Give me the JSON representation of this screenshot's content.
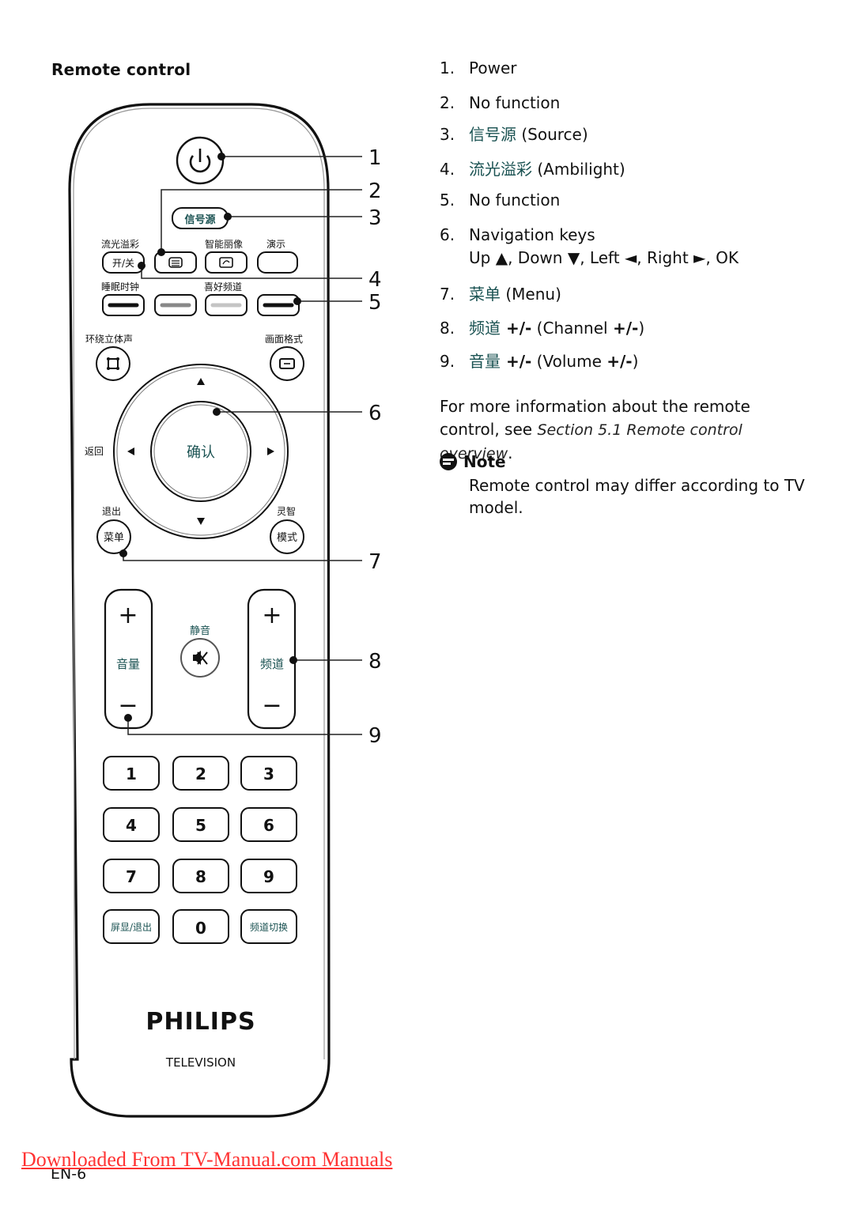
{
  "page": {
    "heading": "Remote control",
    "page_number": "EN-6",
    "footer_link": "Downloaded From TV-Manual.com Manuals"
  },
  "remote": {
    "brand": "PHILIPS",
    "subtitle": "TELEVISION",
    "labels": {
      "source": "信号源",
      "ambilight": "流光溢彩",
      "ambilight_toggle": "开/关",
      "smart_picture": "智能丽像",
      "demo": "演示",
      "sleep_timer": "睡眠时钟",
      "favorite_channels": "喜好频道",
      "surround": "环绕立体声",
      "picture_format": "画面格式",
      "back": "返回",
      "ok": "确认",
      "exit": "退出",
      "menu": "菜单",
      "smart": "灵智",
      "mode": "模式",
      "mute": "静音",
      "volume": "音量",
      "channel": "频道",
      "plus": "+",
      "minus": "−",
      "osd_exit": "屏显/退出",
      "channel_switch": "频道切换"
    },
    "keypad": [
      "1",
      "2",
      "3",
      "4",
      "5",
      "6",
      "7",
      "8",
      "9"
    ],
    "zero": "0",
    "callouts": [
      "1",
      "2",
      "3",
      "4",
      "5",
      "6",
      "7",
      "8",
      "9"
    ],
    "color_keys": [
      "#111111",
      "#888888",
      "#c4c4c4",
      "#111111"
    ]
  },
  "legend": [
    {
      "num": "1.",
      "cn": "",
      "text": "Power"
    },
    {
      "num": "2.",
      "cn": "",
      "text": "No function"
    },
    {
      "num": "3.",
      "cn": "信号源",
      "text": " (Source)"
    },
    {
      "num": "4.",
      "cn": "流光溢彩",
      "text": " (Ambilight)"
    },
    {
      "num": "5.",
      "cn": "",
      "text": "No function"
    },
    {
      "num": "6.",
      "cn": "",
      "text": "Navigation keys"
    },
    {
      "num": "7.",
      "cn": "菜单",
      "text": " (Menu)"
    },
    {
      "num": "8.",
      "cn": "频道",
      "bold": " +/-",
      "text": " (Channel ",
      "bold2": "+/-",
      "tail": ")"
    },
    {
      "num": "9.",
      "cn": "音量",
      "bold": " +/-",
      "text": " (Volume ",
      "bold2": "+/-",
      "tail": ")"
    }
  ],
  "nav_detail": "Up ▲, Down ▼, Left ◄, Right ►, OK",
  "info": {
    "text": "For more information about the remote control, see ",
    "ref": "Section 5.1 Remote control overview",
    "end": "."
  },
  "note": {
    "title": "Note",
    "body": "Remote control may differ according to TV model."
  }
}
